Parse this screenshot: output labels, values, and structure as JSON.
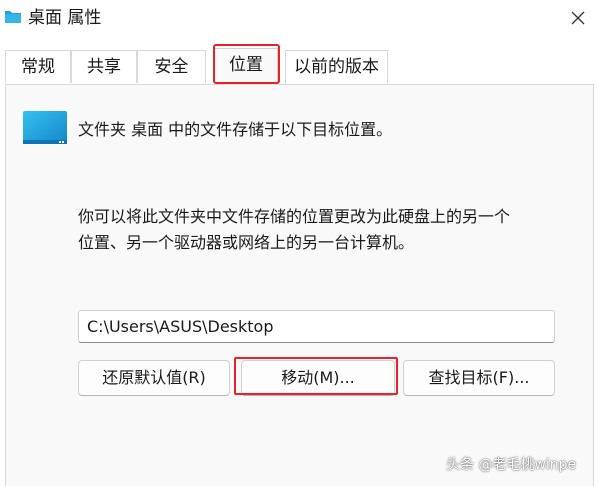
{
  "window": {
    "title": "桌面 属性",
    "folder_icon": "folder-icon",
    "close_icon": "close-icon"
  },
  "tabs": [
    {
      "label": "常规",
      "active": false
    },
    {
      "label": "共享",
      "active": false
    },
    {
      "label": "安全",
      "active": false
    },
    {
      "label": "位置",
      "active": true
    },
    {
      "label": "以前的版本",
      "active": false
    }
  ],
  "location": {
    "description": "文件夹 桌面 中的文件存储于以下目标位置。",
    "info_line1": "你可以将此文件夹中文件存储的位置更改为此硬盘上的另一个",
    "info_line2": "位置、另一个驱动器或网络上的另一台计算机。",
    "path_value": "C:\\Users\\ASUS\\Desktop",
    "restore_button": "还原默认值(R)",
    "move_button": "移动(M)...",
    "find_target_button": "查找目标(F)..."
  },
  "watermark": "头条 @老毛桃winpe",
  "colors": {
    "highlight": "#e8222b",
    "folder_blue": "#1e9fd8",
    "panel_bg": "#f9f9f9"
  }
}
